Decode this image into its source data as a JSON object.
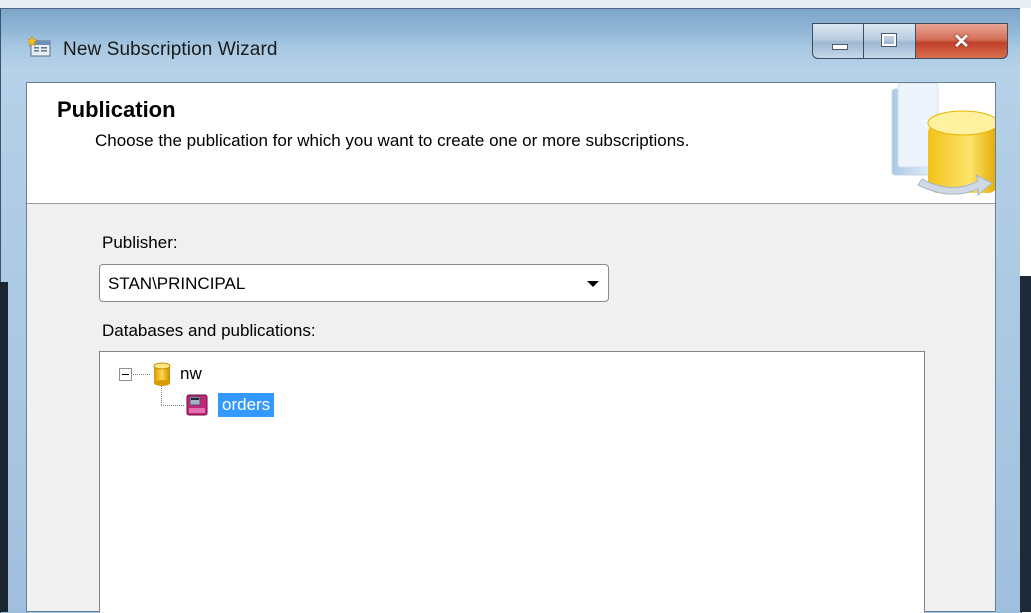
{
  "window": {
    "title": "New Subscription Wizard",
    "icon": "wizard-app-icon",
    "accent_color": "#3399ff",
    "close_color": "#c1412a"
  },
  "header": {
    "title": "Publication",
    "subtitle": "Choose the publication for which you want to create one or more subscriptions.",
    "art_icon": "database-arrow-icon"
  },
  "publisher": {
    "label": "Publisher:",
    "selected": "STAN\\PRINCIPAL"
  },
  "tree": {
    "label": "Databases and publications:",
    "database": {
      "name": "nw",
      "icon": "database-icon",
      "expanded": true,
      "publications": [
        {
          "name": "orders",
          "icon": "publication-icon",
          "selected": true
        }
      ]
    }
  }
}
